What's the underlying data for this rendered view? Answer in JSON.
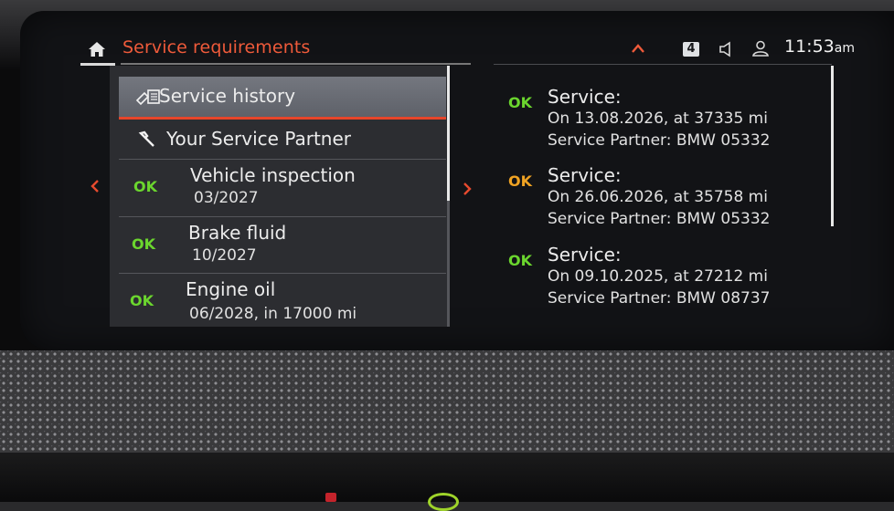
{
  "header": {
    "title": "Service requirements",
    "badge": "4",
    "time": "11:53",
    "ampm": "am",
    "icons": [
      "home-icon",
      "chevron-up-icon",
      "speaker-icon",
      "user-icon"
    ]
  },
  "menu": {
    "items": [
      {
        "label": "Service history",
        "icon": "service-history-icon",
        "selected": true
      },
      {
        "label": "Your Service Partner",
        "icon": "wrench-icon",
        "selected": false
      }
    ]
  },
  "requirements": [
    {
      "status": "OK",
      "name": "Vehicle inspection",
      "due": "03/2027"
    },
    {
      "status": "OK",
      "name": "Brake fluid",
      "due": "10/2027"
    },
    {
      "status": "OK",
      "name": "Engine oil",
      "due": "06/2028, in 17000 mi"
    }
  ],
  "history": [
    {
      "status": "OK",
      "status_color": "#6bd62e",
      "title": "Service:",
      "date_line": "On 13.08.2026, at 37335 mi",
      "partner": "Service Partner: BMW 05332"
    },
    {
      "status": "OK",
      "status_color": "#f0a323",
      "title": "Service:",
      "date_line": "On 26.06.2026, at 35758 mi",
      "partner": "Service Partner: BMW 05332"
    },
    {
      "status": "OK",
      "status_color": "#6bd62e",
      "title": "Service:",
      "date_line": "On 09.10.2025, at 27212 mi",
      "partner": "Service Partner: BMW 08737"
    }
  ],
  "colors": {
    "accent": "#ee5a3a",
    "ok_green": "#6bd62e",
    "ok_orange": "#f0a323"
  }
}
